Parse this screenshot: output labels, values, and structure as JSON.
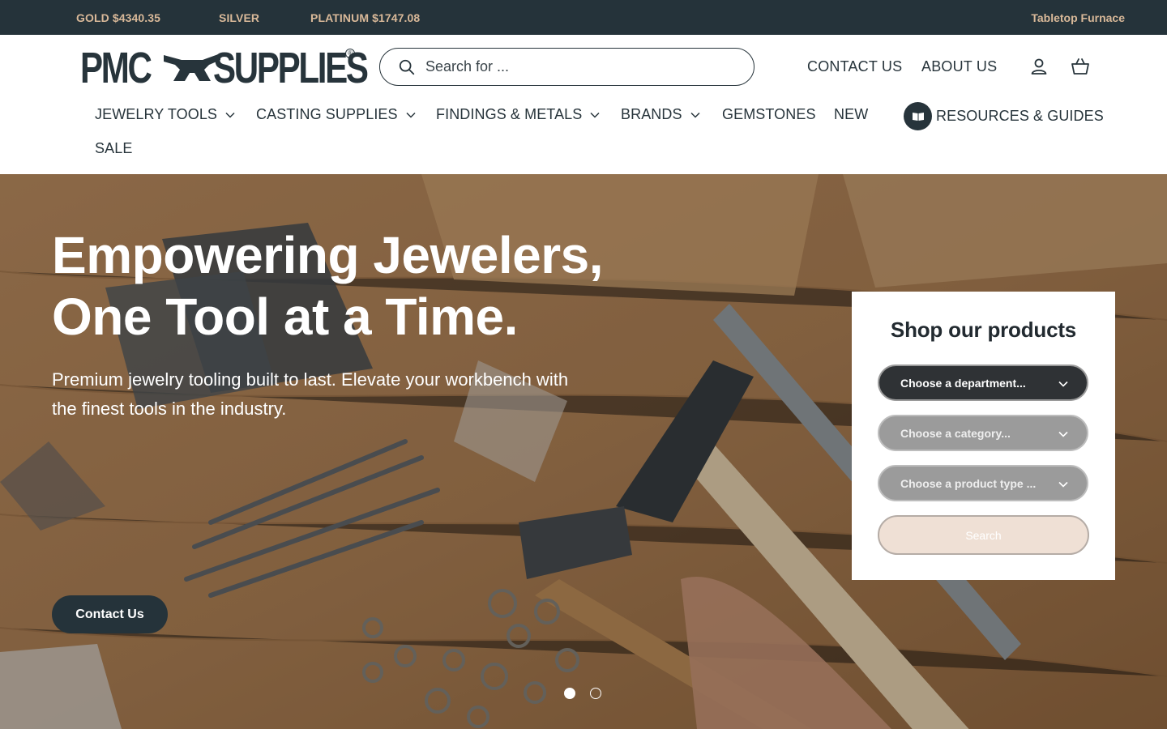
{
  "topbar": {
    "metals": [
      "GOLD $4340.35",
      "SILVER",
      "PLATINUM $1747.08"
    ],
    "promo": "Tabletop Furnace"
  },
  "header": {
    "logo_left": "PMC",
    "logo_right": "SUPPLIES",
    "logo_mark": "®",
    "search_placeholder": "Search for ...",
    "links": [
      "CONTACT US",
      "ABOUT US"
    ],
    "icons": [
      "account-icon",
      "cart-icon"
    ]
  },
  "nav": {
    "items": [
      {
        "label": "JEWELRY TOOLS",
        "dropdown": true
      },
      {
        "label": "CASTING SUPPLIES",
        "dropdown": true
      },
      {
        "label": "FINDINGS & METALS",
        "dropdown": true
      },
      {
        "label": "BRANDS",
        "dropdown": true
      },
      {
        "label": "GEMSTONES",
        "dropdown": false
      },
      {
        "label": "NEW",
        "dropdown": false
      },
      {
        "label": "RESOURCES & GUIDES",
        "dropdown": false
      },
      {
        "label": "SALE",
        "dropdown": false
      }
    ]
  },
  "hero": {
    "title": "Empowering Jewelers, One Tool at a Time.",
    "subtitle": "Premium jewelry tooling built to last. Elevate your workbench with the finest tools in the industry.",
    "cta": "Contact Us",
    "slides": 2,
    "active_slide": 1
  },
  "shop_panel": {
    "title": "Shop our products",
    "selects": [
      {
        "label": "Choose a department...",
        "enabled": true
      },
      {
        "label": "Choose a category...",
        "enabled": false
      },
      {
        "label": "Choose a product type ...",
        "enabled": false
      }
    ],
    "search_button": "Search"
  },
  "colors": {
    "topbar_bg": "#25333a",
    "topbar_text": "#d9b999",
    "brand_dark": "#27343b",
    "search_button_bg": "#efe0d5"
  }
}
